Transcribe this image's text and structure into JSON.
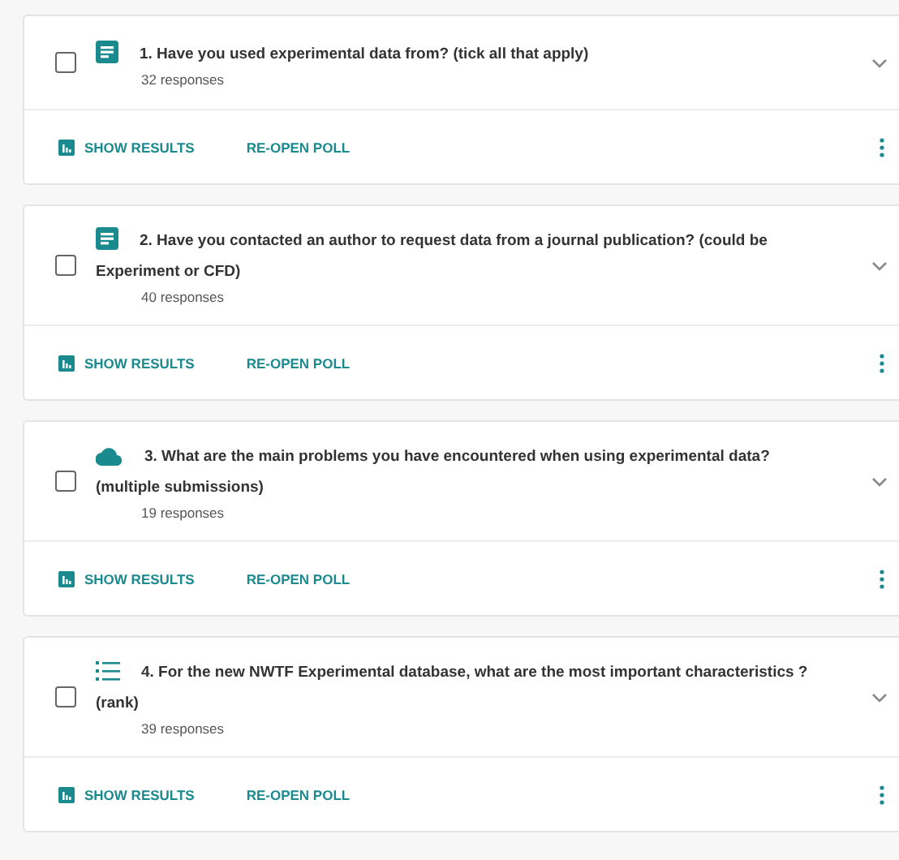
{
  "polls": [
    {
      "kind": "text",
      "checked": false,
      "title": "1. Have you used experimental data from? (tick all that apply)",
      "responses": "32 responses",
      "actions": [
        "SHOW RESULTS",
        "RE-OPEN POLL"
      ]
    },
    {
      "kind": "text",
      "checked": false,
      "title": "2. Have you contacted an author to request data from a journal publication? (could be Experiment or CFD)",
      "responses": "40 responses",
      "actions": [
        "SHOW RESULTS",
        "RE-OPEN POLL"
      ]
    },
    {
      "kind": "cloud",
      "checked": false,
      "title": "3. What are the main problems you have encountered when using experimental data? (multiple submissions)",
      "responses": "19 responses",
      "actions": [
        "SHOW RESULTS",
        "RE-OPEN POLL"
      ]
    },
    {
      "kind": "ranking",
      "checked": false,
      "title": "4. For the new NWTF Experimental database, what are the most important characteristics ? (rank)",
      "responses": "39 responses",
      "actions": [
        "SHOW RESULTS",
        "RE-OPEN POLL"
      ]
    }
  ]
}
